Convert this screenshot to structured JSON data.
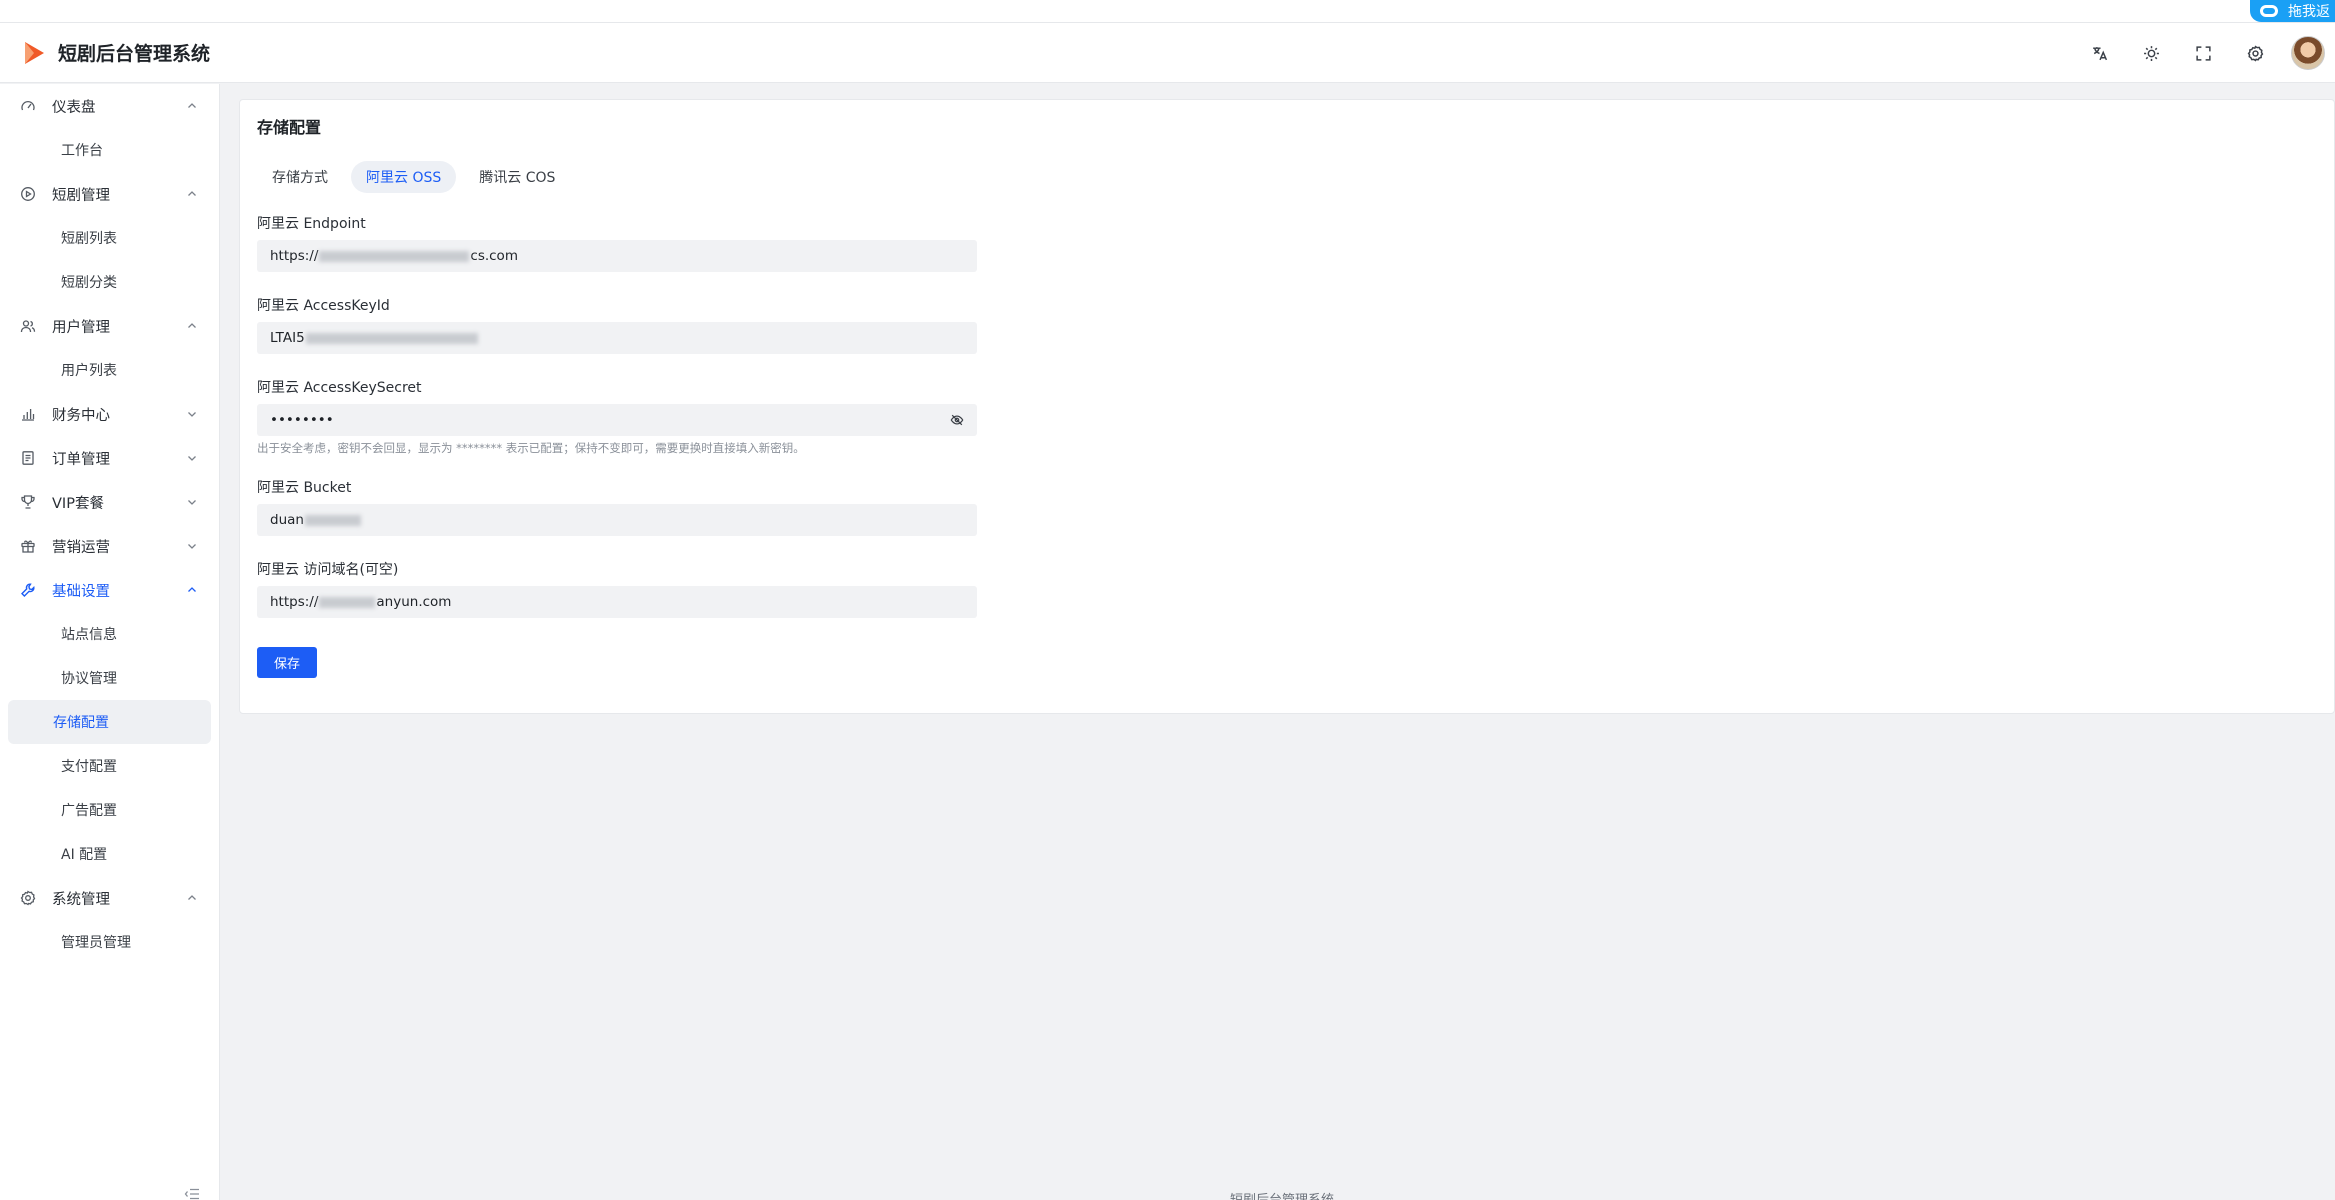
{
  "app": {
    "title": "短剧后台管理系统",
    "footer": "短剧后台管理系统",
    "accent": "#1d5df5"
  },
  "float_badge": {
    "label": "拖我返"
  },
  "header_tools": [
    {
      "name": "translate-icon"
    },
    {
      "name": "theme-sun-icon"
    },
    {
      "name": "fullscreen-icon"
    },
    {
      "name": "settings-icon"
    }
  ],
  "sidebar": {
    "groups": [
      {
        "label": "仪表盘",
        "icon": "dashboard-icon",
        "expanded": true,
        "items": [
          "工作台"
        ]
      },
      {
        "label": "短剧管理",
        "icon": "play-circle-icon",
        "expanded": true,
        "items": [
          "短剧列表",
          "短剧分类"
        ]
      },
      {
        "label": "用户管理",
        "icon": "users-icon",
        "expanded": true,
        "items": [
          "用户列表"
        ]
      },
      {
        "label": "财务中心",
        "icon": "bar-chart-icon",
        "expanded": false,
        "items": []
      },
      {
        "label": "订单管理",
        "icon": "document-icon",
        "expanded": false,
        "items": []
      },
      {
        "label": "VIP套餐",
        "icon": "trophy-icon",
        "expanded": false,
        "items": []
      },
      {
        "label": "营销运营",
        "icon": "gift-icon",
        "expanded": false,
        "items": []
      },
      {
        "label": "基础设置",
        "icon": "wrench-icon",
        "expanded": true,
        "active": true,
        "items": [
          "站点信息",
          "协议管理",
          "存储配置",
          "支付配置",
          "广告配置",
          "AI 配置"
        ]
      },
      {
        "label": "系统管理",
        "icon": "gear-icon",
        "expanded": true,
        "items": [
          "管理员管理"
        ]
      }
    ],
    "selected_item": "存储配置"
  },
  "page": {
    "title": "存储配置",
    "tabs": [
      {
        "label": "存储方式",
        "active": false
      },
      {
        "label": "阿里云 OSS",
        "active": true
      },
      {
        "label": "腾讯云 COS",
        "active": false
      }
    ],
    "fields": [
      {
        "label": "阿里云 Endpoint",
        "prefix": "https://",
        "suffix": "cs.com"
      },
      {
        "label": "阿里云 AccessKeyId",
        "prefix": "LTAI5",
        "suffix": ""
      },
      {
        "label": "阿里云 AccessKeySecret",
        "prefix": "••••••••",
        "suffix": ""
      },
      {
        "label": "阿里云 Bucket",
        "prefix": "duan",
        "suffix": ""
      },
      {
        "label": "阿里云 访问域名(可空)",
        "prefix": "https://",
        "suffix": "anyun.com"
      }
    ],
    "secret_hint": "出于安全考虑，密钥不会回显，显示为 ******** 表示已配置；保持不变即可，需要更换时直接填入新密钥。",
    "save_label": "保存"
  }
}
